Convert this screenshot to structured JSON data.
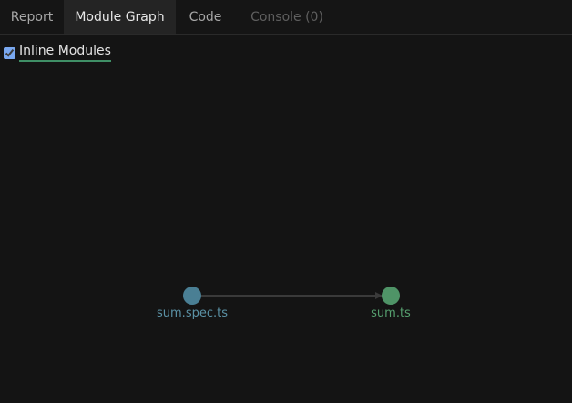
{
  "tabs": [
    {
      "label": "Report",
      "state": "normal"
    },
    {
      "label": "Module Graph",
      "state": "active"
    },
    {
      "label": "Code",
      "state": "normal"
    },
    {
      "label": "Console (0)",
      "state": "disabled"
    }
  ],
  "toolbar": {
    "inline_modules": {
      "label": "Inline Modules",
      "checked": true
    }
  },
  "graph": {
    "nodes": [
      {
        "id": "sum.spec.ts",
        "label": "sum.spec.ts",
        "color": "#4a7f94",
        "label_color": "#5b92a6"
      },
      {
        "id": "sum.ts",
        "label": "sum.ts",
        "color": "#4f9467",
        "label_color": "#56a06f"
      }
    ],
    "edges": [
      {
        "from": "sum.spec.ts",
        "to": "sum.ts",
        "color": "#3a3a3a"
      }
    ]
  },
  "colors": {
    "background": "#141414",
    "tab_active_bg": "#242424",
    "accent_underline": "#3f8f66"
  }
}
